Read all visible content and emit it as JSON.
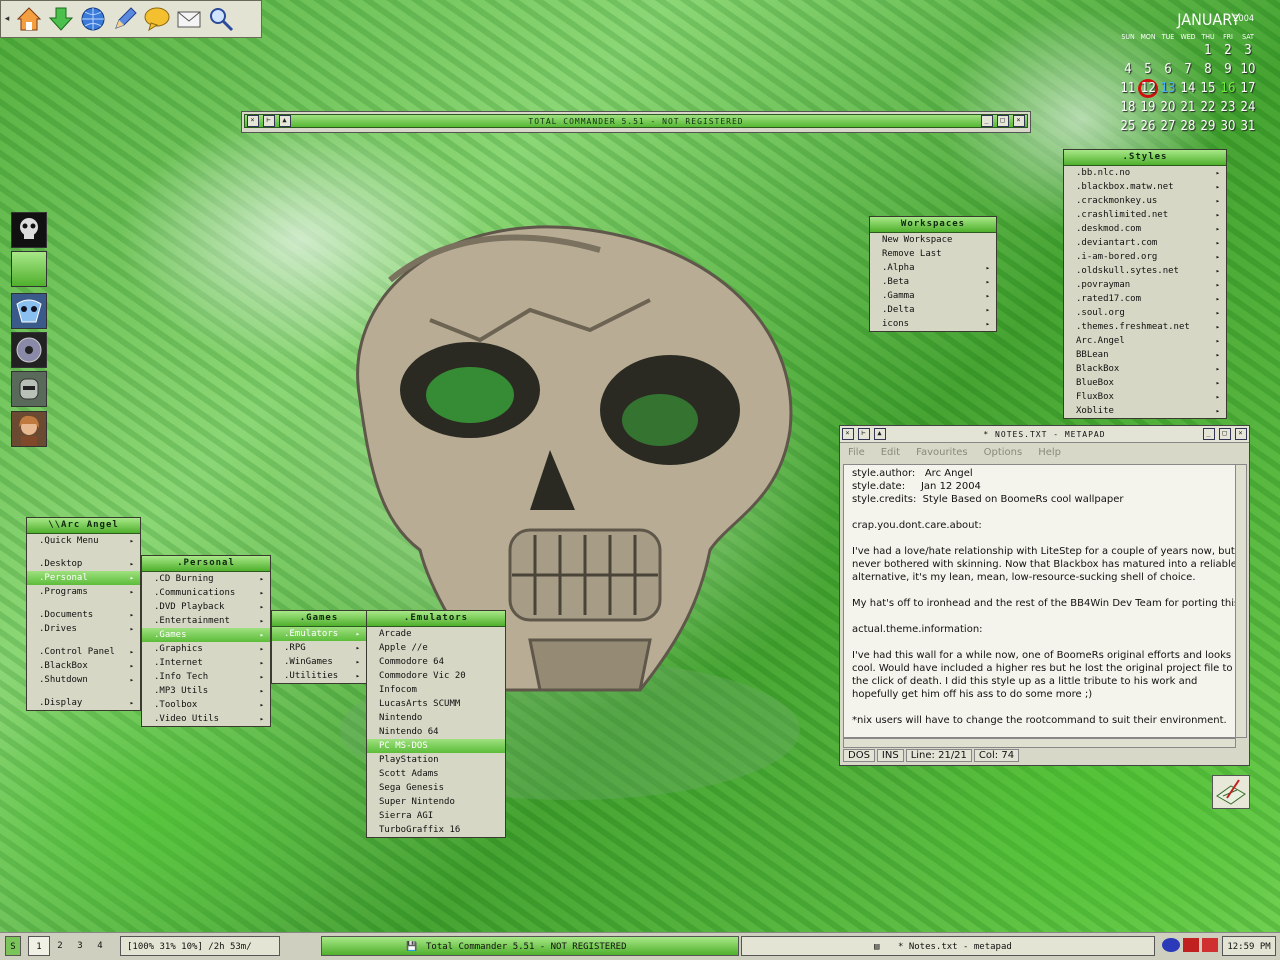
{
  "calendar": {
    "month": "JANUARY",
    "year": "2004",
    "dows": [
      "SUN",
      "MON",
      "TUE",
      "WED",
      "THU",
      "FRI",
      "SAT"
    ],
    "days": [
      "",
      "",
      "",
      "",
      "1",
      "2",
      "3",
      "4",
      "5",
      "6",
      "7",
      "8",
      "9",
      "10",
      "11",
      "12",
      "13",
      "14",
      "15",
      "16",
      "17",
      "18",
      "19",
      "20",
      "21",
      "22",
      "23",
      "24",
      "25",
      "26",
      "27",
      "28",
      "29",
      "30",
      "31"
    ],
    "today": "12"
  },
  "toolbar": {
    "icons": [
      "home-icon",
      "download-arrow-icon",
      "globe-icon",
      "pencil-tool-icon",
      "chat-bubble-icon",
      "envelope-icon",
      "magnifier-icon"
    ]
  },
  "total_commander": {
    "title": "TOTAL COMMANDER 5.51 - NOT REGISTERED"
  },
  "workspaces_menu": {
    "title": "Workspaces",
    "items": [
      "New Workspace",
      "Remove Last",
      ".Alpha",
      ".Beta",
      ".Gamma",
      ".Delta",
      "icons"
    ]
  },
  "styles_menu": {
    "title": ".Styles",
    "items": [
      ".bb.nlc.no",
      ".blackbox.matw.net",
      ".crackmonkey.us",
      ".crashlimited.net",
      ".deskmod.com",
      ".deviantart.com",
      ".i-am-bored.org",
      ".oldskull.sytes.net",
      ".povrayman",
      ".rated17.com",
      ".soul.org",
      ".themes.freshmeat.net",
      "Arc.Angel",
      "BBLean",
      "BlackBox",
      "BlueBox",
      "FluxBox",
      "Xoblite"
    ]
  },
  "root_menu": {
    "title": "\\\\Arc Angel",
    "items": [
      ".Quick Menu",
      ".Desktop",
      ".Personal",
      ".Programs",
      ".Documents",
      ".Drives",
      ".Control Panel",
      ".BlackBox",
      ".Shutdown",
      ".Display"
    ]
  },
  "personal_menu": {
    "title": ".Personal",
    "items": [
      ".CD Burning",
      ".Communications",
      ".DVD Playback",
      ".Entertainment",
      ".Games",
      ".Graphics",
      ".Internet",
      ".Info Tech",
      ".MP3 Utils",
      ".Toolbox",
      ".Video Utils"
    ]
  },
  "games_menu": {
    "title": ".Games",
    "items": [
      ".Emulators",
      ".RPG",
      ".WinGames",
      ".Utilities"
    ]
  },
  "emulators_menu": {
    "title": ".Emulators",
    "items": [
      "Arcade",
      "Apple //e",
      "Commodore 64",
      "Commodore Vic 20",
      "Infocom",
      "LucasArts SCUMM",
      "Nintendo",
      "Nintendo 64",
      "PC MS-DOS",
      "PlayStation",
      "Scott Adams",
      "Sega Genesis",
      "Super Nintendo",
      "Sierra AGI",
      "TurboGraffix 16"
    ]
  },
  "metapad": {
    "title": "* NOTES.TXT - METAPAD",
    "menu": [
      "File",
      "Edit",
      "Favourites",
      "Options",
      "Help"
    ],
    "lines": [
      "style.author:   Arc Angel",
      "style.date:     Jan 12 2004",
      "style.credits:  Style Based on BoomeRs cool wallpaper",
      "",
      "crap.you.dont.care.about:",
      "",
      "I've had a love/hate relationship with LiteStep for a couple of years now, but",
      "never bothered with skinning. Now that Blackbox has matured into a reliable sh",
      "alternative, it's my lean, mean, low-resource-sucking shell of choice.",
      "",
      "My hat's off to ironhead and the rest of the BB4Win Dev Team for porting this!",
      "",
      "actual.theme.information:",
      "",
      "I've had this wall for a while now, one of BoomeRs original efforts and looks",
      "cool. Would have included a higher res but he lost the original project file to",
      "the click of death. I did this style up as a little tribute to his work and",
      "hopefully get him off his ass to do some more ;)",
      "",
      "*nix users will have to change the rootcommand to suit their environment."
    ],
    "status": [
      "DOS",
      "INS",
      "Line: 21/21",
      "Col: 74"
    ]
  },
  "taskbar": {
    "workspaces": [
      "1",
      "2",
      "3",
      "4"
    ],
    "stats": "[100% 31% 10%] /2h 53m/",
    "tasks": [
      "Total Commander 5.51 - NOT REGISTERED",
      "* Notes.txt - metapad"
    ],
    "clock": "12:59 PM"
  }
}
